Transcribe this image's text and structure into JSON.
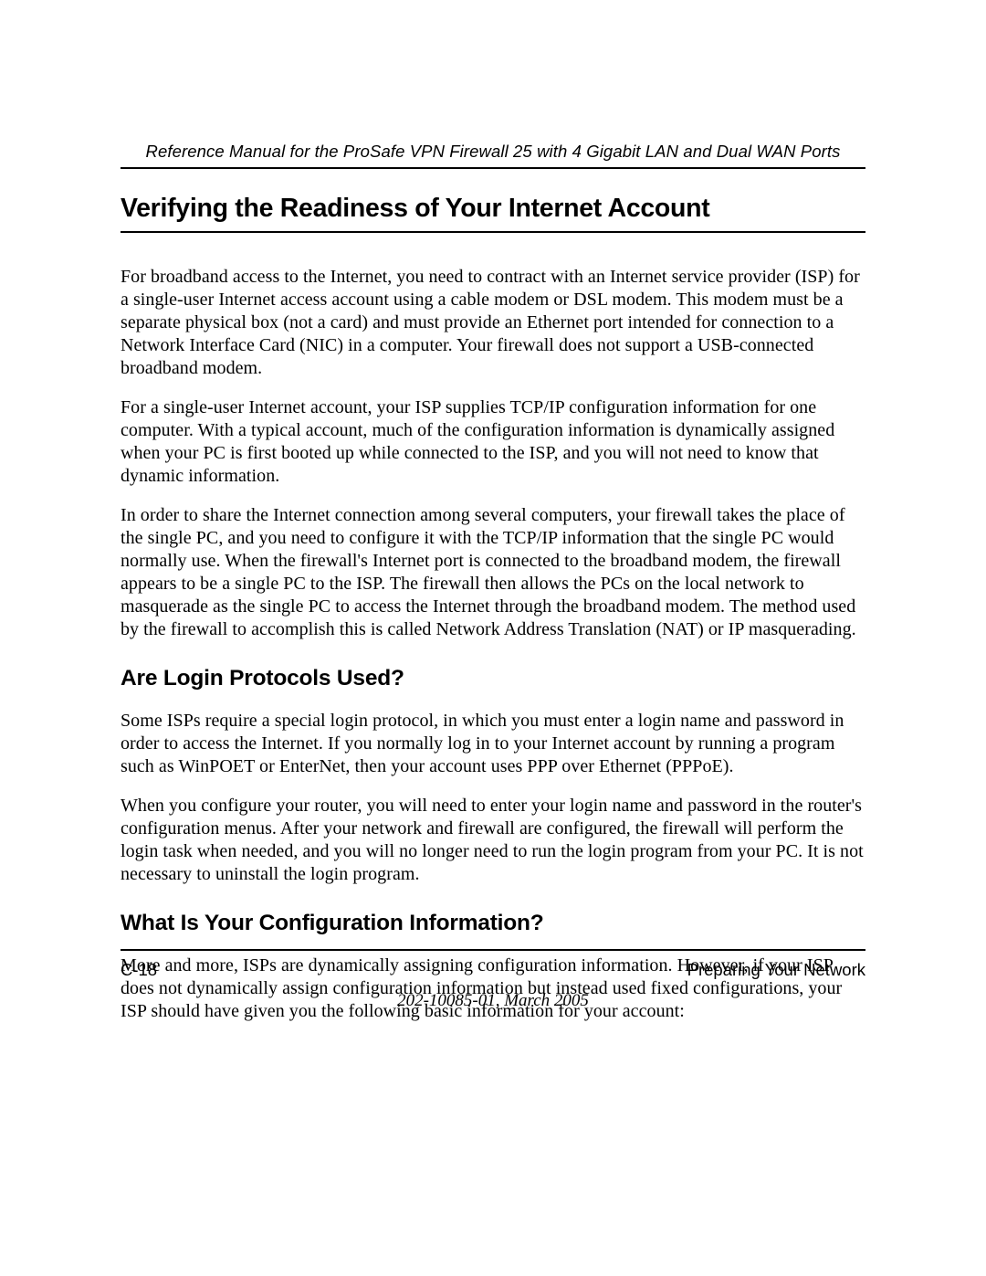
{
  "header": {
    "title": "Reference Manual for the ProSafe VPN Firewall 25 with 4 Gigabit LAN and Dual WAN Ports"
  },
  "section1": {
    "heading": "Verifying the Readiness of Your Internet Account",
    "para1": "For broadband access to the Internet, you need to contract with an Internet service provider (ISP) for a single-user Internet access account using a cable modem or DSL modem. This modem must be a separate physical box (not a card) and must provide an Ethernet port intended for connection to a Network Interface Card (NIC) in a computer. Your firewall does not support a USB-connected broadband modem.",
    "para2": "For a single-user Internet account, your ISP supplies TCP/IP configuration information for one computer. With a typical account, much of the configuration information is dynamically assigned when your PC is first booted up while connected to the ISP, and you will not need to know that dynamic information.",
    "para3": "In order to share the Internet connection among several computers, your firewall takes the place of the single PC, and you need to configure it with the TCP/IP information that the single PC would normally use. When the firewall's Internet port is connected to the broadband modem, the firewall appears to be a single PC to the ISP. The firewall then allows the PCs on the local network to masquerade as the single PC to access the Internet through the broadband modem. The method used by the firewall to accomplish this is called Network Address Translation (NAT) or IP masquerading."
  },
  "section2": {
    "heading": "Are Login Protocols Used?",
    "para1": "Some ISPs require a special login protocol, in which you must enter a login name and password in order to access the Internet. If you normally log in to your Internet account by running a program such as WinPOET or EnterNet, then your account uses PPP over Ethernet (PPPoE).",
    "para2": "When you configure your router, you will need to enter your login name and password in the router's configuration menus. After your network and firewall are configured, the firewall will perform the login task when needed, and you will no longer need to run the login program from your PC. It is not necessary to uninstall the login program."
  },
  "section3": {
    "heading": "What Is Your Configuration Information?",
    "para1": "More and more, ISPs are dynamically assigning configuration information. However, if your ISP does not dynamically assign configuration information but instead used fixed configurations, your ISP should have given you the following basic information for your account:"
  },
  "footer": {
    "pageNumber": "C-18",
    "sectionTitle": "Preparing Your Network",
    "docInfo": "202-10085-01, March 2005"
  }
}
